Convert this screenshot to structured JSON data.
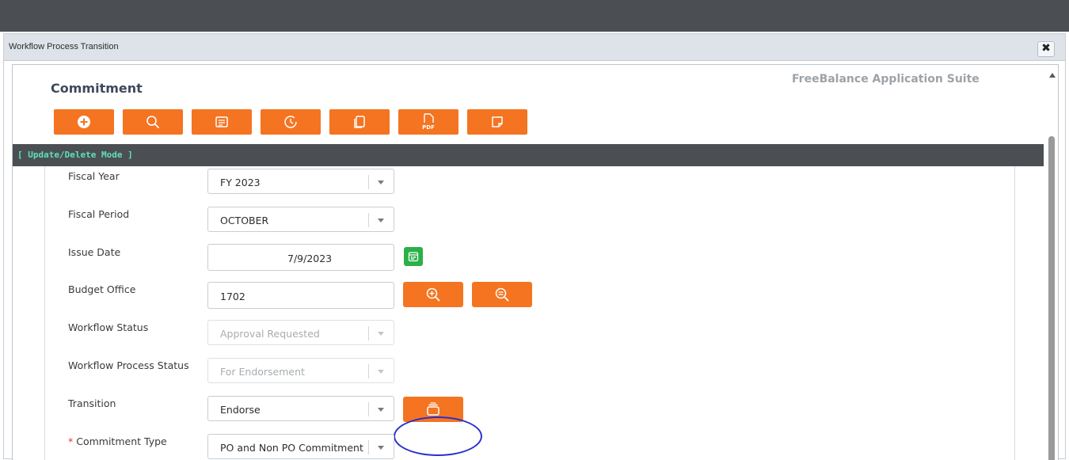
{
  "dialog": {
    "title": "Workflow Process Transition",
    "close_label": "✖"
  },
  "header": {
    "page_title": "Commitment",
    "suite_title": "FreeBalance Application Suite"
  },
  "toolbar": {
    "buttons": [
      {
        "name": "add",
        "icon": "plus-circle-icon"
      },
      {
        "name": "search",
        "icon": "search-icon"
      },
      {
        "name": "details",
        "icon": "list-icon"
      },
      {
        "name": "history",
        "icon": "clock-icon"
      },
      {
        "name": "copy",
        "icon": "copy-icon"
      },
      {
        "name": "pdf",
        "icon": "pdf-icon",
        "label": "PDF"
      },
      {
        "name": "notes",
        "icon": "note-icon"
      }
    ]
  },
  "mode": {
    "label": "[ Update/Delete Mode ]"
  },
  "form": {
    "fiscal_year": {
      "label": "Fiscal Year",
      "value": "FY 2023"
    },
    "fiscal_period": {
      "label": "Fiscal Period",
      "value": "OCTOBER"
    },
    "issue_date": {
      "label": "Issue Date",
      "value": "7/9/2023"
    },
    "budget_office": {
      "label": "Budget Office",
      "value": "1702"
    },
    "workflow_status": {
      "label": "Workflow Status",
      "value": "Approval Requested"
    },
    "workflow_process_status": {
      "label": "Workflow Process Status",
      "value": "For Endorsement"
    },
    "transition": {
      "label": "Transition",
      "value": "Endorse"
    },
    "commitment_type": {
      "label": "Commitment Type",
      "required_mark": "*",
      "value": "PO and Non PO Commitment"
    }
  },
  "colors": {
    "accent": "#f47421",
    "topbar": "#4b4f53",
    "mode_text": "#5ee0b8",
    "calendar_button": "#2bb04a",
    "highlight": "#2b2fcf"
  }
}
